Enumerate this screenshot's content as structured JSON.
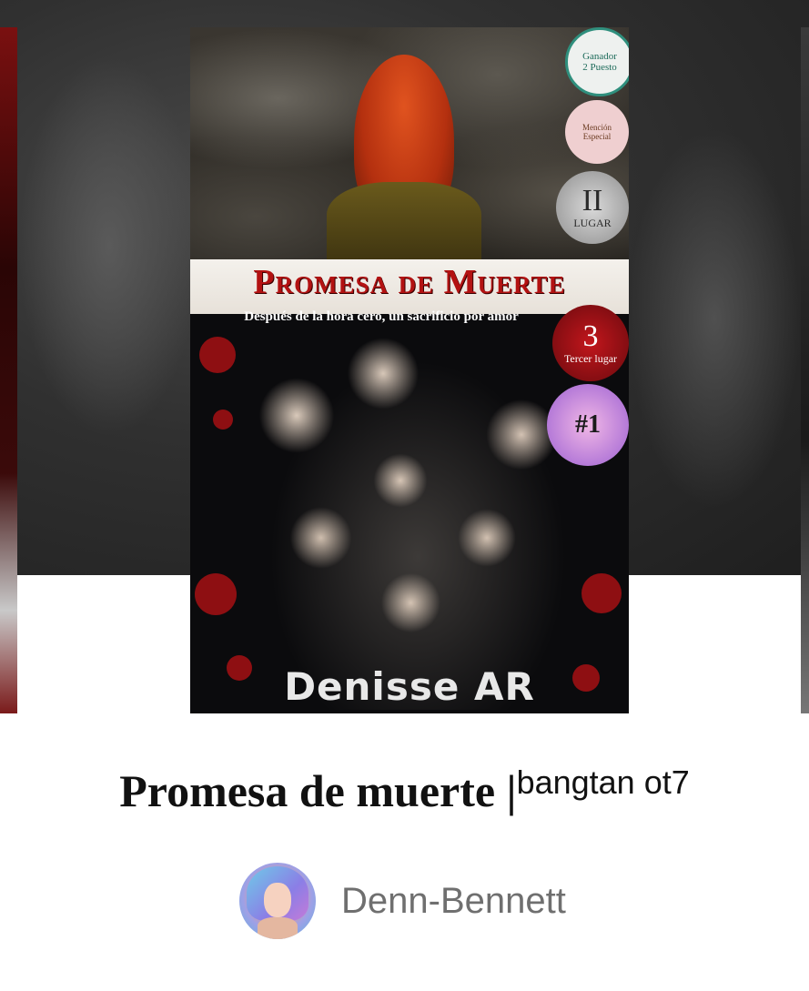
{
  "cover": {
    "title": "Promesa de Muerte",
    "tagline": "Después de la hora cero, un sacrificio por amor",
    "author": "Denisse AR",
    "badges": [
      {
        "name": "ganador-badge",
        "line1": "Ganador",
        "line2": "2 Puesto"
      },
      {
        "name": "mencion-especial-badge",
        "line1": "Mención",
        "line2": "Especial"
      },
      {
        "name": "segundo-lugar-badge",
        "line1": "II",
        "line2": "LUGAR"
      },
      {
        "name": "tercer-lugar-badge",
        "line1": "3",
        "line2": "Tercer lugar"
      },
      {
        "name": "numero-uno-badge",
        "line1": "#1"
      }
    ]
  },
  "story": {
    "title": "Promesa de muerte |",
    "title_suffix": "bangtan ot7"
  },
  "author": {
    "name": "Denn-Bennett"
  },
  "colors": {
    "title_red": "#b31212",
    "author_gray": "#6f6f6f",
    "backdrop": "#2b2b2b"
  }
}
